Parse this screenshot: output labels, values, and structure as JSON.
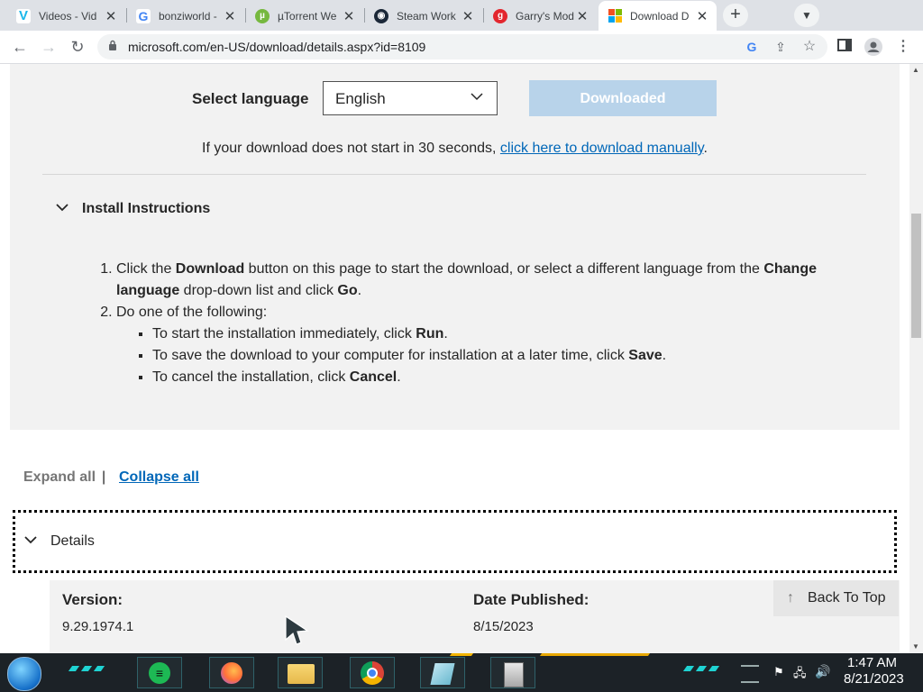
{
  "browser": {
    "tabs": [
      {
        "title": "Videos - Vid",
        "favicon": "vimeo-icon"
      },
      {
        "title": "bonziworld -",
        "favicon": "google-icon"
      },
      {
        "title": "µTorrent We",
        "favicon": "utorrent-icon"
      },
      {
        "title": "Steam Work",
        "favicon": "steam-icon"
      },
      {
        "title": "Garry's Mod",
        "favicon": "garrysmod-icon"
      },
      {
        "title": "Download D",
        "favicon": "microsoft-icon"
      }
    ],
    "active_tab": 5,
    "new_tab_symbol": "+",
    "url": "microsoft.com/en-US/download/details.aspx?id=8109"
  },
  "download": {
    "select_language_label": "Select language",
    "language_value": "English",
    "download_button_label": "Downloaded",
    "manual_prefix": "If your download does not start in 30 seconds, ",
    "manual_link": "click here to download manually",
    "manual_suffix": "."
  },
  "install": {
    "title": "Install Instructions",
    "step1": {
      "a": "Click the ",
      "b": "Download",
      "c": " button on this page to start the download, or select a different language from the ",
      "d": "Change language",
      "e": " drop-down list and click ",
      "f": "Go",
      "g": "."
    },
    "step2": "Do one of the following:",
    "bullets": [
      {
        "text": "To start the installation immediately, click ",
        "bold": "Run",
        "end": "."
      },
      {
        "text": "To save the download to your computer for installation at a later time, click ",
        "bold": "Save",
        "end": "."
      },
      {
        "text": "To cancel the installation, click ",
        "bold": "Cancel",
        "end": "."
      }
    ]
  },
  "expand_all": "Expand all",
  "separator": "|",
  "collapse_all": "Collapse all",
  "details": {
    "title": "Details",
    "version_label": "Version:",
    "version_value": "9.29.1974.1",
    "date_label": "Date Published:",
    "date_value": "8/15/2023"
  },
  "back_to_top": "Back To Top",
  "taskbar": {
    "time": "1:47 AM",
    "date": "8/21/2023",
    "apps": [
      "spotify-icon",
      "firefox-icon",
      "file-explorer-icon",
      "chrome-icon",
      "notes-icon",
      "installer-icon"
    ]
  }
}
